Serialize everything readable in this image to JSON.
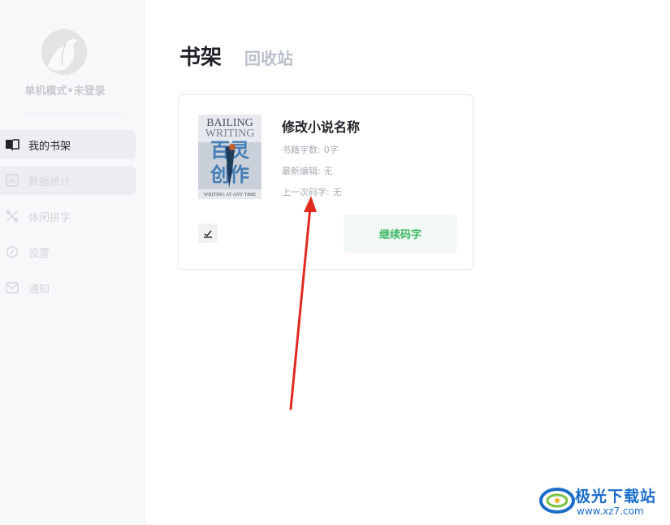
{
  "sidebar": {
    "user_status": "单机模式•未登录",
    "items": [
      {
        "label": "我的书架",
        "icon": "book-icon"
      },
      {
        "label": "数据统计",
        "icon": "chart-icon"
      },
      {
        "label": "休闲拼字",
        "icon": "puzzle-icon"
      },
      {
        "label": "设置",
        "icon": "gear-icon"
      },
      {
        "label": "通知",
        "icon": "mail-icon"
      }
    ]
  },
  "main": {
    "title": "书架",
    "tab_recycle": "回收站"
  },
  "card": {
    "book_name": "修改小说名称",
    "word_count_label": "书籍字数:",
    "word_count_value": "0字",
    "last_edit_label": "最新编辑:",
    "last_edit_value": "无",
    "last_type_label": "上一次码字:",
    "last_type_value": "无",
    "continue_label": "继续码字",
    "cover": {
      "line1": "BAILING",
      "line2": "WRITING",
      "cn1": "百灵",
      "cn2": "创作",
      "bottom": "WRITING AT ANY TIME"
    }
  },
  "watermark": {
    "name": "极光下载站",
    "url": "www.xz7.com"
  },
  "colors": {
    "accent_green": "#3fb866",
    "arrow_red": "#e02a20",
    "watermark_blue": "#1a6cc8"
  }
}
